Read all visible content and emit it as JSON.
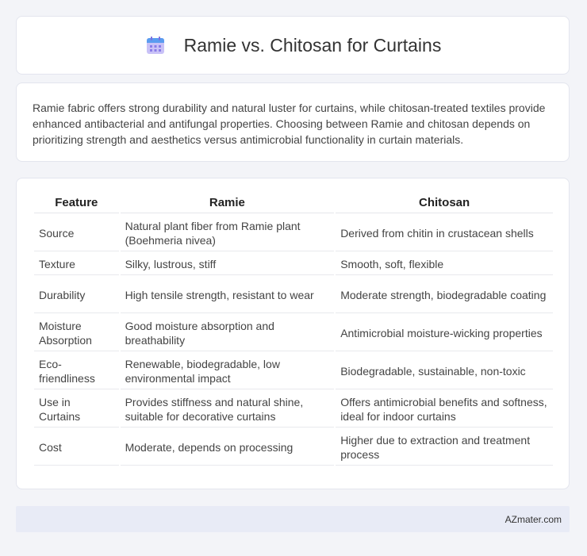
{
  "header": {
    "title": "Ramie vs. Chitosan for Curtains",
    "icon": "calendar-icon"
  },
  "intro": {
    "text": "Ramie fabric offers strong durability and natural luster for curtains, while chitosan-treated textiles provide enhanced antibacterial and antifungal properties. Choosing between Ramie and chitosan depends on prioritizing strength and aesthetics versus antimicrobial functionality in curtain materials."
  },
  "table": {
    "headers": [
      "Feature",
      "Ramie",
      "Chitosan"
    ],
    "rows": [
      [
        "Source",
        "Natural plant fiber from Ramie plant (Boehmeria nivea)",
        "Derived from chitin in crustacean shells"
      ],
      [
        "Texture",
        "Silky, lustrous, stiff",
        "Smooth, soft, flexible"
      ],
      [
        "Durability",
        "High tensile strength, resistant to wear",
        "Moderate strength, biodegradable coating"
      ],
      [
        "Moisture Absorption",
        "Good moisture absorption and breathability",
        "Antimicrobial moisture-wicking properties"
      ],
      [
        "Eco-friendliness",
        "Renewable, biodegradable, low environmental impact",
        "Biodegradable, sustainable, non-toxic"
      ],
      [
        "Use in Curtains",
        "Provides stiffness and natural shine, suitable for decorative curtains",
        "Offers antimicrobial benefits and softness, ideal for indoor curtains"
      ],
      [
        "Cost",
        "Moderate, depends on processing",
        "Higher due to extraction and treatment process"
      ]
    ]
  },
  "footer": {
    "text": "AZmater.com"
  },
  "colors": {
    "page_background": "#f3f4f8",
    "card_background": "#ffffff",
    "footer_background": "#e8ebf6",
    "icon_purple": "#9b8ef0",
    "icon_blue": "#5a9cf0"
  }
}
